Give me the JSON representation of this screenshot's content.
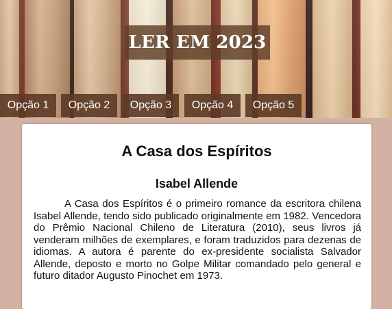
{
  "header": {
    "title": "LER EM 2023"
  },
  "nav": {
    "items": [
      {
        "label": "Opção 1"
      },
      {
        "label": "Opção 2"
      },
      {
        "label": "Opção 3"
      },
      {
        "label": "Opção 4"
      },
      {
        "label": "Opção 5"
      }
    ]
  },
  "article": {
    "title": "A Casa dos Espíritos",
    "author": "Isabel Allende",
    "description": "A Casa dos Espíritos é o primeiro romance da escritora chilena Isabel Allende, tendo sido publicado originalmente em 1982. Vencedora do Prêmio Nacional Chileno de Literatura (2010), seus livros já venderam milhões de exemplares, e foram traduzidos para dezenas de idiomas. A autora é parente do ex-presidente socialista Salvador Allende, deposto e morto no Golpe Militar comandado pelo general e futuro ditador Augusto Pinochet em 1973."
  },
  "colors": {
    "page_background": "#d3b1a3",
    "title_box": "#5f3e28",
    "nav_button": "#5c3a26",
    "card_background": "#ffffff"
  }
}
